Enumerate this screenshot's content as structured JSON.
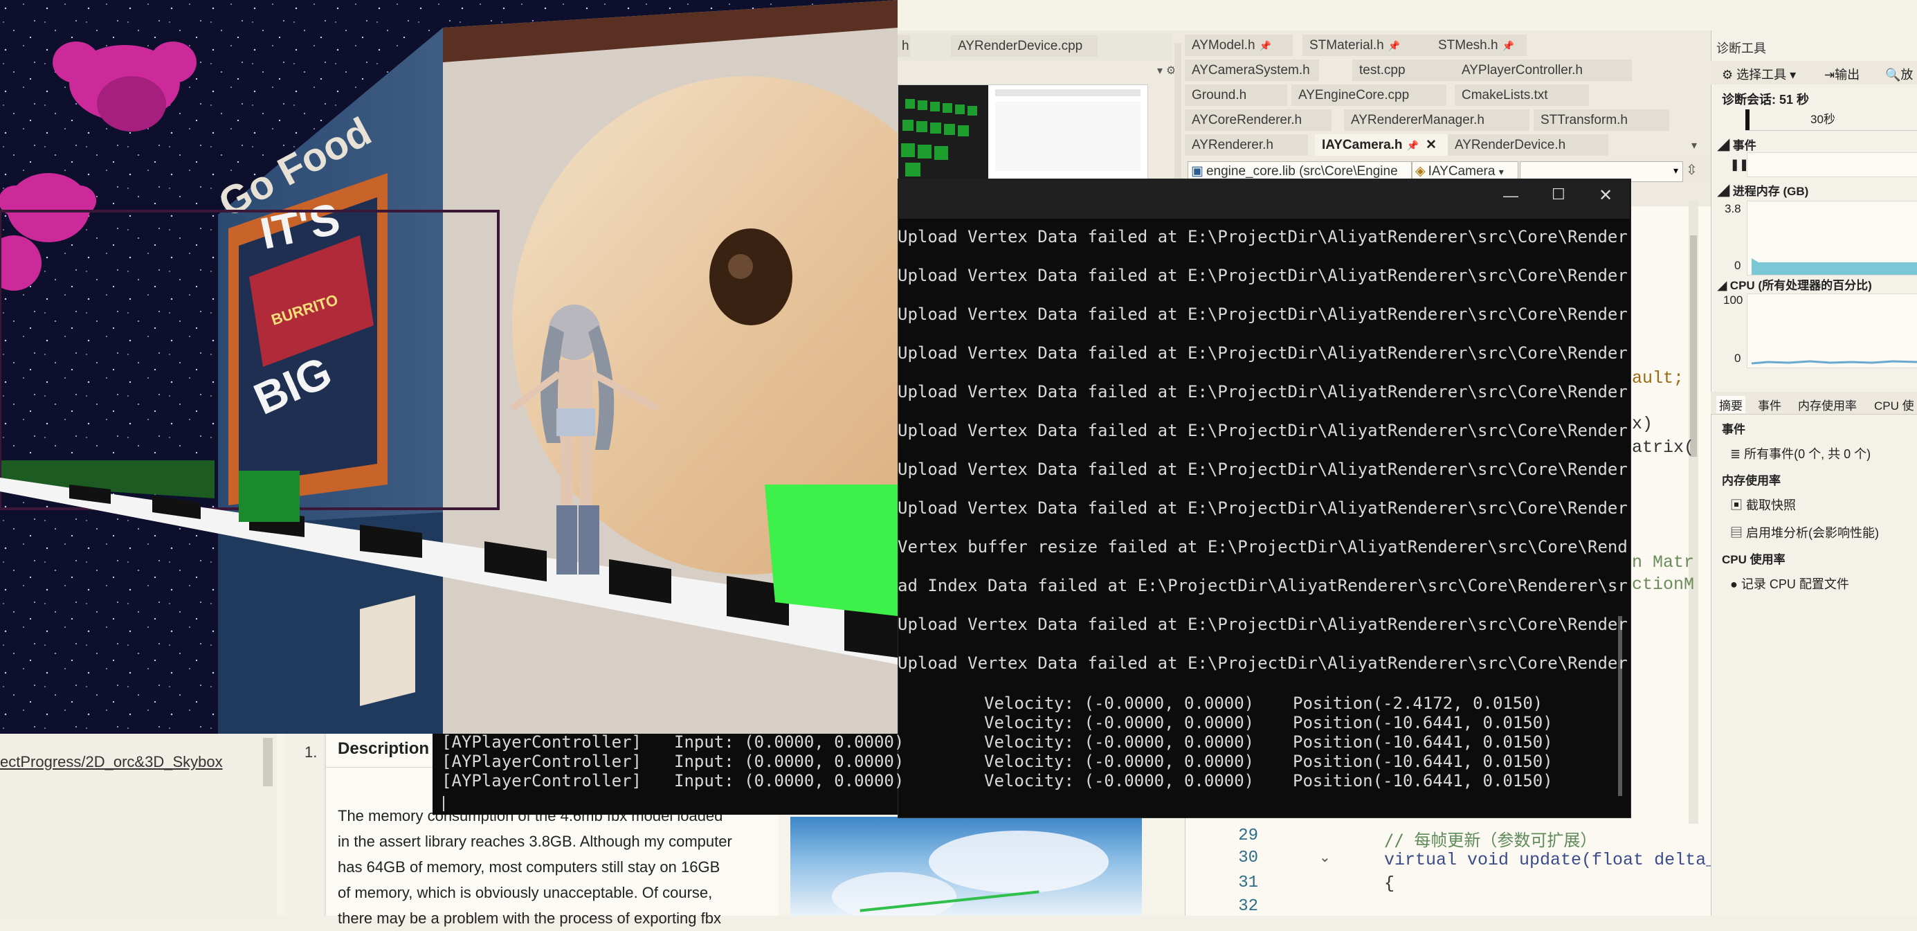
{
  "vs": {
    "tabs_row1": [
      "h",
      "AYRenderDevice.cpp"
    ],
    "tabs_row1_right": [
      "AYModel.h",
      "STMaterial.h",
      "STMesh.h"
    ],
    "tabs_row2": [
      "AYCameraSystem.h",
      "test.cpp",
      "AYPlayerController.h"
    ],
    "tabs_row3": [
      "Ground.h",
      "AYEngineCore.cpp",
      "CmakeLists.txt"
    ],
    "tabs_row4": [
      "AYCoreRenderer.h",
      "AYRendererManager.h",
      "STTransform.h"
    ],
    "tabs_row5": [
      "AYRenderer.h",
      "IAYCamera.h",
      "AYRenderDevice.h"
    ],
    "project_dropdown": "engine_core.lib (src\\Core\\Engine",
    "class_dropdown": "IAYCamera",
    "code_fragments": [
      "ault;",
      "x)",
      "atrix(",
      "n Matr",
      "ctionM"
    ],
    "line_numbers": [
      "29",
      "30",
      "31",
      "32"
    ],
    "code_lines": [
      "// 每帧更新（参数可扩展）",
      "virtual void update(float delta_",
      "{"
    ]
  },
  "diagnostics": {
    "title": "诊断工具",
    "select_tool": "选择工具",
    "output": "输出",
    "zoom": "放",
    "session": "诊断会话: 51 秒",
    "timeline_tick": "30秒",
    "events_header": "事件",
    "memory_header": "进程内存 (GB)",
    "memory_max": "3.8",
    "memory_min": "0",
    "cpu_header": "CPU (所有处理器的百分比)",
    "cpu_max": "100",
    "cpu_min": "0",
    "tabs": [
      "摘要",
      "事件",
      "内存使用率",
      "CPU 使"
    ],
    "sec_events": "事件",
    "all_events": "所有事件(0 个, 共 0 个)",
    "sec_memory": "内存使用率",
    "snapshot": "截取快照",
    "heap_profile": "启用堆分析(会影响性能)",
    "sec_cpu": "CPU 使用率",
    "record_cpu": "记录 CPU 配置文件"
  },
  "console": {
    "lines": [
      "Upload Vertex Data failed at E:\\ProjectDir\\AliyatRenderer\\src\\Core\\Render",
      "Upload Vertex Data failed at E:\\ProjectDir\\AliyatRenderer\\src\\Core\\Render",
      "Upload Vertex Data failed at E:\\ProjectDir\\AliyatRenderer\\src\\Core\\Render",
      "Upload Vertex Data failed at E:\\ProjectDir\\AliyatRenderer\\src\\Core\\Render",
      "Upload Vertex Data failed at E:\\ProjectDir\\AliyatRenderer\\src\\Core\\Render",
      "Upload Vertex Data failed at E:\\ProjectDir\\AliyatRenderer\\src\\Core\\Render",
      "Upload Vertex Data failed at E:\\ProjectDir\\AliyatRenderer\\src\\Core\\Render",
      "Upload Vertex Data failed at E:\\ProjectDir\\AliyatRenderer\\src\\Core\\Render",
      "Vertex buffer resize failed at E:\\ProjectDir\\AliyatRenderer\\src\\Core\\Rend",
      "ad Index Data failed at E:\\ProjectDir\\AliyatRenderer\\src\\Core\\Renderer\\sr",
      "Upload Vertex Data failed at E:\\ProjectDir\\AliyatRenderer\\src\\Core\\Render",
      "Upload Vertex Data failed at E:\\ProjectDir\\AliyatRenderer\\src\\Core\\Render"
    ],
    "first_velocity": "Velocity: (-0.0000, 0.0000)",
    "first_position": "Position(-2.4172, 0.0150)",
    "player_rows": [
      {
        "tag": "[AYPlayerController]",
        "input": "Input: (0.0000, 0.0000)",
        "velocity": "Velocity: (-0.0000, 0.0000)",
        "position": "Position(-10.6441, 0.0150)"
      },
      {
        "tag": "[AYPlayerController]",
        "input": "Input: (0.0000, 0.0000)",
        "velocity": "Velocity: (-0.0000, 0.0000)",
        "position": "Position(-10.6441, 0.0150)"
      },
      {
        "tag": "[AYPlayerController]",
        "input": "Input: (0.0000, 0.0000)",
        "velocity": "Velocity: (-0.0000, 0.0000)",
        "position": "Position(-10.6441, 0.0150)"
      },
      {
        "tag": "[AYPlayerController]",
        "input": "Input: (0.0000, 0.0000)",
        "velocity": "Velocity: (-0.0000, 0.0000)",
        "position": "Position(-10.6441, 0.0150)"
      }
    ]
  },
  "doc": {
    "path_link": "ectProgress/2D_orc&3D_Skybox",
    "item_number": "1.",
    "description_header": "Description",
    "paragraph_lines": [
      "The memory consumption of the 4.6mb fbx model loaded",
      "in the assert library reaches 3.8GB. Although my computer",
      "has 64GB of memory, most computers still stay on 16GB",
      "of memory, which is obviously unacceptable. Of course,",
      "there may be a problem with the process of exporting fbx"
    ]
  },
  "game": {
    "sign_text": "IT'S",
    "sign_text2": "BIG",
    "sign_small": "BURRITO",
    "top_sign": "Go Food"
  },
  "colors": {
    "console_bg": "#0c0c0c",
    "console_text": "#d9d9d9",
    "checker_dark": "#111111",
    "green_cube": "#3df04a",
    "monkey_magenta": "#d0289b"
  }
}
